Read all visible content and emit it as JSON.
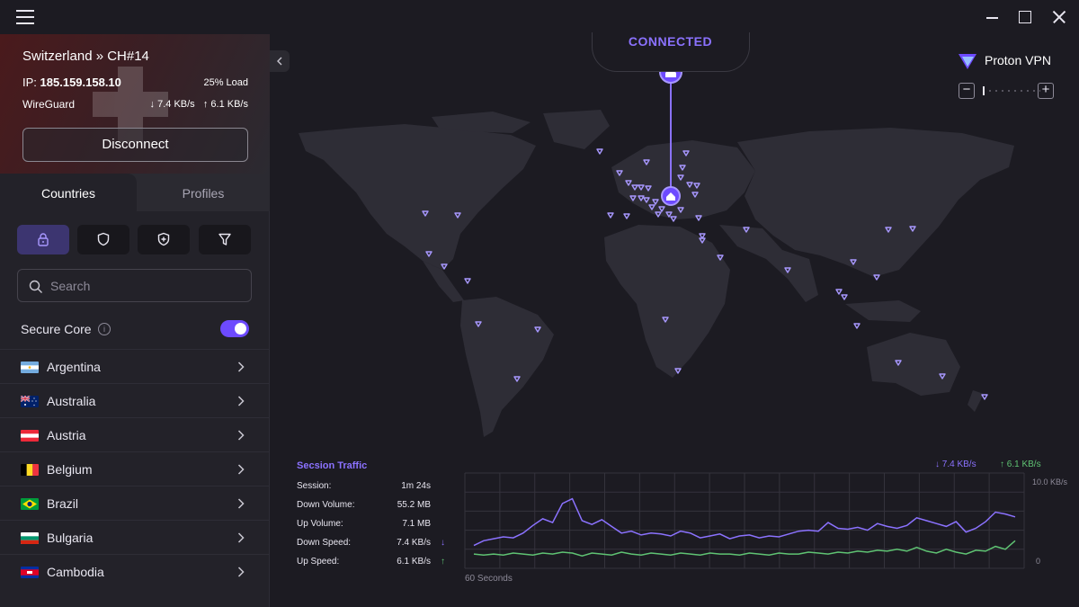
{
  "app": {
    "name": "Proton VPN",
    "status": "CONNECTED"
  },
  "connection": {
    "server": "Switzerland » CH#14",
    "ip_label": "IP:",
    "ip": "185.159.158.10",
    "load": "25% Load",
    "protocol": "WireGuard",
    "down": "↓ 7.4 KB/s",
    "up": "↑ 6.1 KB/s",
    "disconnect_label": "Disconnect"
  },
  "tabs": [
    {
      "label": "Countries"
    },
    {
      "label": "Profiles"
    }
  ],
  "filters": [
    "lock-icon",
    "shield-icon",
    "shield-plus-icon",
    "filter-icon"
  ],
  "search": {
    "placeholder": "Search",
    "value": ""
  },
  "secure_core": {
    "label": "Secure Core",
    "enabled": true
  },
  "countries": [
    {
      "name": "Argentina",
      "flag": "argentina-flag"
    },
    {
      "name": "Australia",
      "flag": "australia-flag"
    },
    {
      "name": "Austria",
      "flag": "austria-flag"
    },
    {
      "name": "Belgium",
      "flag": "belgium-flag"
    },
    {
      "name": "Brazil",
      "flag": "brazil-flag"
    },
    {
      "name": "Bulgaria",
      "flag": "bulgaria-flag"
    },
    {
      "name": "Cambodia",
      "flag": "cambodia-flag"
    }
  ],
  "map": {
    "zoom_in": "+",
    "zoom_out": "−"
  },
  "traffic": {
    "title": "Secsion Traffic",
    "rows": [
      {
        "label": "Session:",
        "value": "1m 24s",
        "arrow": ""
      },
      {
        "label": "Down Volume:",
        "value": "55.2 MB",
        "arrow": ""
      },
      {
        "label": "Up Volume:",
        "value": "7.1 MB",
        "arrow": ""
      },
      {
        "label": "Down Speed:",
        "value": "7.4 KB/s",
        "arrow": "↓"
      },
      {
        "label": "Up Speed:",
        "value": "6.1 KB/s",
        "arrow": "↑"
      }
    ],
    "legend_down": "↓ 7.4 KB/s",
    "legend_up": "↑ 6.1 KB/s",
    "y_max_label": "10.0 KB/s",
    "y_min_label": "0",
    "x_label": "60 Seconds"
  },
  "colors": {
    "accent": "#6d4aff",
    "accent_text": "#8b72ff",
    "upload": "#5fc373",
    "background": "#1c1b22",
    "sidebar": "#232229"
  },
  "chart_data": {
    "type": "line",
    "xlabel": "60 Seconds",
    "ylabel": "",
    "ylim": [
      0,
      10
    ],
    "grid": true,
    "series": [
      {
        "name": "↓ 7.4 KB/s",
        "color": "#8b72ff",
        "values": [
          2.4,
          2.9,
          3.1,
          3.3,
          3.2,
          3.7,
          4.5,
          5.2,
          4.8,
          6.8,
          7.3,
          5.0,
          4.6,
          5.1,
          4.4,
          3.7,
          3.9,
          3.5,
          3.7,
          3.6,
          3.4,
          3.9,
          3.7,
          3.2,
          3.4,
          3.6,
          3.1,
          3.4,
          3.5,
          3.2,
          3.4,
          3.3,
          3.6,
          3.9,
          4.0,
          3.9,
          4.8,
          4.2,
          4.1,
          4.3,
          4.0,
          4.7,
          4.4,
          4.2,
          4.5,
          5.3,
          5.0,
          4.7,
          4.4,
          4.9,
          3.8,
          4.2,
          4.9,
          5.9,
          5.7,
          5.4
        ]
      },
      {
        "name": "↑ 6.1 KB/s",
        "color": "#5fc373",
        "values": [
          1.5,
          1.4,
          1.5,
          1.4,
          1.6,
          1.5,
          1.4,
          1.6,
          1.5,
          1.7,
          1.6,
          1.3,
          1.6,
          1.5,
          1.4,
          1.7,
          1.5,
          1.4,
          1.6,
          1.5,
          1.4,
          1.6,
          1.5,
          1.4,
          1.6,
          1.5,
          1.5,
          1.4,
          1.6,
          1.5,
          1.4,
          1.6,
          1.5,
          1.5,
          1.7,
          1.6,
          1.5,
          1.7,
          1.6,
          1.8,
          1.7,
          1.9,
          1.8,
          2.0,
          1.8,
          2.2,
          1.8,
          1.6,
          2.0,
          1.7,
          1.5,
          1.9,
          1.8,
          2.3,
          2.0,
          2.9
        ]
      }
    ]
  }
}
